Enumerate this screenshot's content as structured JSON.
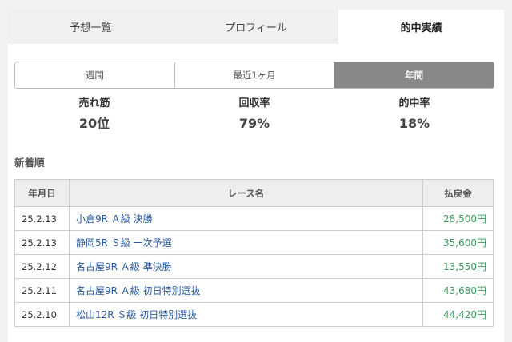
{
  "tabs": [
    {
      "label": "予想一覧",
      "active": false
    },
    {
      "label": "プロフィール",
      "active": false
    },
    {
      "label": "的中実績",
      "active": true
    }
  ],
  "periods": [
    {
      "label": "週間",
      "active": false
    },
    {
      "label": "最近1ヶ月",
      "active": false
    },
    {
      "label": "年間",
      "active": true
    }
  ],
  "stats": [
    {
      "label": "売れ筋",
      "value": "20位"
    },
    {
      "label": "回収率",
      "value": "79%"
    },
    {
      "label": "的中率",
      "value": "18%"
    }
  ],
  "section_title": "新着順",
  "table": {
    "headers": [
      "年月日",
      "レース名",
      "払戻金"
    ],
    "rows": [
      {
        "date": "25.2.13",
        "race": "小倉9R Ａ級 決勝",
        "payout": "28,500円"
      },
      {
        "date": "25.2.13",
        "race": "静岡5R Ｓ級 一次予選",
        "payout": "35,600円"
      },
      {
        "date": "25.2.12",
        "race": "名古屋9R Ａ級 準決勝",
        "payout": "13,550円"
      },
      {
        "date": "25.2.11",
        "race": "名古屋9R Ａ級 初日特別選抜",
        "payout": "43,680円"
      },
      {
        "date": "25.2.10",
        "race": "松山12R Ｓ級 初日特別選抜",
        "payout": "44,420円"
      }
    ]
  },
  "colors": {
    "active_period": "#888888",
    "link": "#2a5aa0",
    "payout": "#3d9a5c"
  }
}
